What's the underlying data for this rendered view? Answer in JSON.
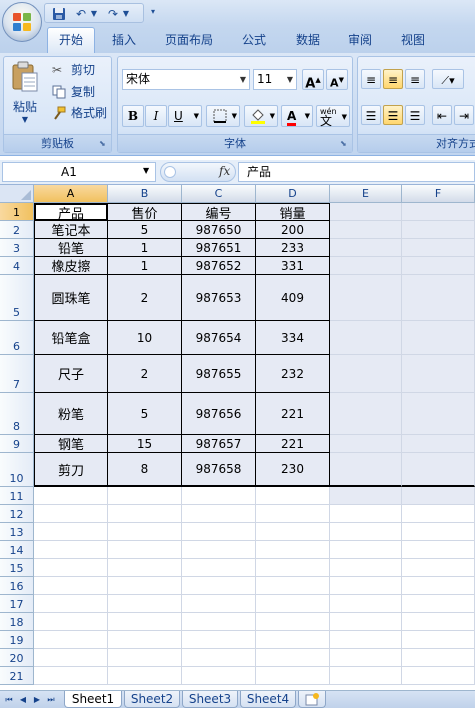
{
  "ribbon": {
    "tabs": [
      "开始",
      "插入",
      "页面布局",
      "公式",
      "数据",
      "审阅",
      "视图"
    ],
    "active_tab": "开始",
    "clipboard": {
      "paste": "粘贴",
      "cut": "剪切",
      "copy": "复制",
      "format_painter": "格式刷",
      "label": "剪贴板"
    },
    "font": {
      "name": "宋体",
      "size": "11",
      "bold": "B",
      "italic": "I",
      "underline": "U",
      "font_color": "A",
      "phonetic": "wén",
      "grow": "A",
      "shrink": "A",
      "label": "字体"
    },
    "alignment": {
      "label": "对齐方式"
    }
  },
  "formula_bar": {
    "name_box": "A1",
    "fx": "fx",
    "content": "产品"
  },
  "columns": [
    "A",
    "B",
    "C",
    "D",
    "E",
    "F"
  ],
  "rows": [
    "1",
    "2",
    "3",
    "4",
    "5",
    "6",
    "7",
    "8",
    "9",
    "10",
    "11",
    "12",
    "13",
    "14",
    "15",
    "16",
    "17",
    "18",
    "19",
    "20",
    "21"
  ],
  "table": {
    "headers": [
      "产品",
      "售价",
      "编号",
      "销量"
    ],
    "rows": [
      [
        "笔记本",
        "5",
        "987650",
        "200"
      ],
      [
        "铅笔",
        "1",
        "987651",
        "233"
      ],
      [
        "橡皮擦",
        "1",
        "987652",
        "331"
      ],
      [
        "圆珠笔",
        "2",
        "987653",
        "409"
      ],
      [
        "铅笔盒",
        "10",
        "987654",
        "334"
      ],
      [
        "尺子",
        "2",
        "987655",
        "232"
      ],
      [
        "粉笔",
        "5",
        "987656",
        "221"
      ],
      [
        "钢笔",
        "15",
        "987657",
        "221"
      ],
      [
        "剪刀",
        "8",
        "987658",
        "230"
      ]
    ]
  },
  "sheets": [
    "Sheet1",
    "Sheet2",
    "Sheet3",
    "Sheet4"
  ],
  "active_sheet": "Sheet1",
  "colors": {
    "accent": "#f1c15f",
    "ribbon": "#c9daf1",
    "selection": "#e6eaf4"
  }
}
